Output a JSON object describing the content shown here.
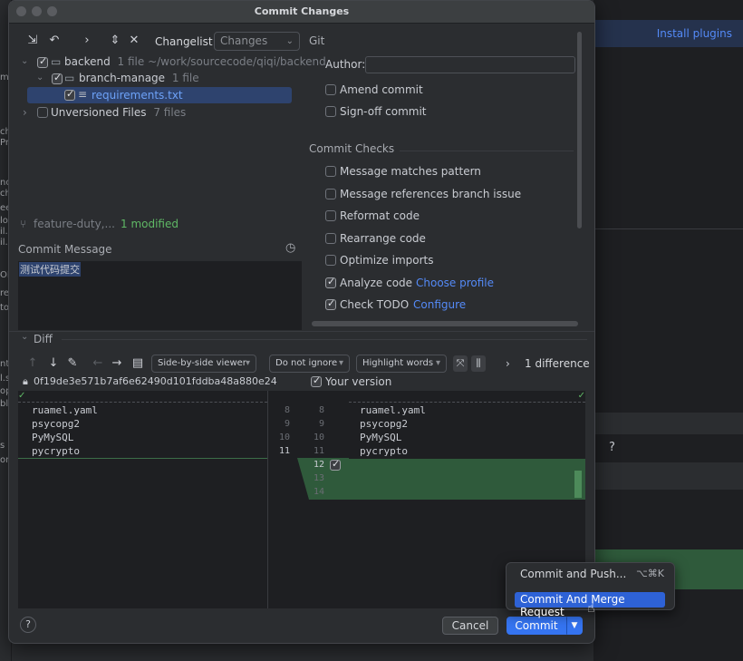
{
  "background": {
    "left_strip_lines": [
      "m",
      "ch",
      "Pr",
      "",
      "no",
      "ch",
      "ee",
      "lo",
      "il.",
      "il.",
      "OM",
      "re",
      "to",
      "",
      "",
      "nt",
      "l.s",
      "op",
      "bl",
      "s",
      "on"
    ],
    "install_plugins": "Install plugins",
    "right_help": "?"
  },
  "dialog": {
    "title": "Commit Changes"
  },
  "toolbar": {
    "changelist_label": "Changelist:",
    "changelist_value": "Changes",
    "icons": [
      "collapse-arrows-icon",
      "undo-icon",
      "chevron-right-icon",
      "expand-collapse-icon",
      "collapse-icon"
    ]
  },
  "tree": {
    "root": {
      "name": "backend",
      "info": "1 file  ~/work/sourcecode/qiqi/backend"
    },
    "folder": {
      "name": "branch-manage",
      "info": "1 file"
    },
    "file": {
      "name": "requirements.txt"
    },
    "unversioned": {
      "name": "Unversioned Files",
      "info": "7 files"
    }
  },
  "branch": {
    "name": "feature-duty,...",
    "status": "1 modified"
  },
  "commit_message": {
    "label": "Commit Message",
    "text": "测试代码提交"
  },
  "git_options": {
    "section": "Git",
    "author_label": "Author:",
    "author_value": "",
    "amend": "Amend commit",
    "signoff": "Sign-off commit"
  },
  "commit_checks": {
    "section": "Commit Checks",
    "items": [
      {
        "label": "Message matches pattern",
        "checked": false,
        "link": ""
      },
      {
        "label": "Message references branch issue",
        "checked": false,
        "link": ""
      },
      {
        "label": "Reformat code",
        "checked": false,
        "link": ""
      },
      {
        "label": "Rearrange code",
        "checked": false,
        "link": ""
      },
      {
        "label": "Optimize imports",
        "checked": false,
        "link": ""
      },
      {
        "label": "Analyze code",
        "checked": true,
        "link": "Choose profile"
      },
      {
        "label": "Check TODO",
        "checked": true,
        "link": "Configure"
      }
    ]
  },
  "diff": {
    "label": "Diff",
    "viewer": "Side-by-side viewer",
    "ignore": "Do not ignore",
    "highlight": "Highlight words",
    "difference_count": "1 difference",
    "left_hash": "0f19de3e571b7af6e62490d101fddba48a880e24",
    "right_label": "Your version",
    "left_lines": [
      "ruamel.yaml",
      "psycopg2",
      "PyMySQL",
      "pycrypto"
    ],
    "left_numbers": [
      "8",
      "9",
      "10",
      "11"
    ],
    "right_numbers": [
      "8",
      "9",
      "10",
      "11",
      "12",
      "13",
      "14"
    ],
    "right_lines": [
      "ruamel.yaml",
      "psycopg2",
      "PyMySQL",
      "pycrypto"
    ]
  },
  "footer": {
    "help": "?",
    "cancel": "Cancel",
    "commit": "Commit"
  },
  "popup": {
    "commit_push": "Commit and Push...",
    "commit_push_shortcut": "⌥⌘K",
    "commit_merge": "Commit And Merge Request"
  },
  "colors": {
    "accent": "#3574f0",
    "link": "#548af7",
    "added": "#2f5a3b",
    "green_text": "#5fb865"
  }
}
